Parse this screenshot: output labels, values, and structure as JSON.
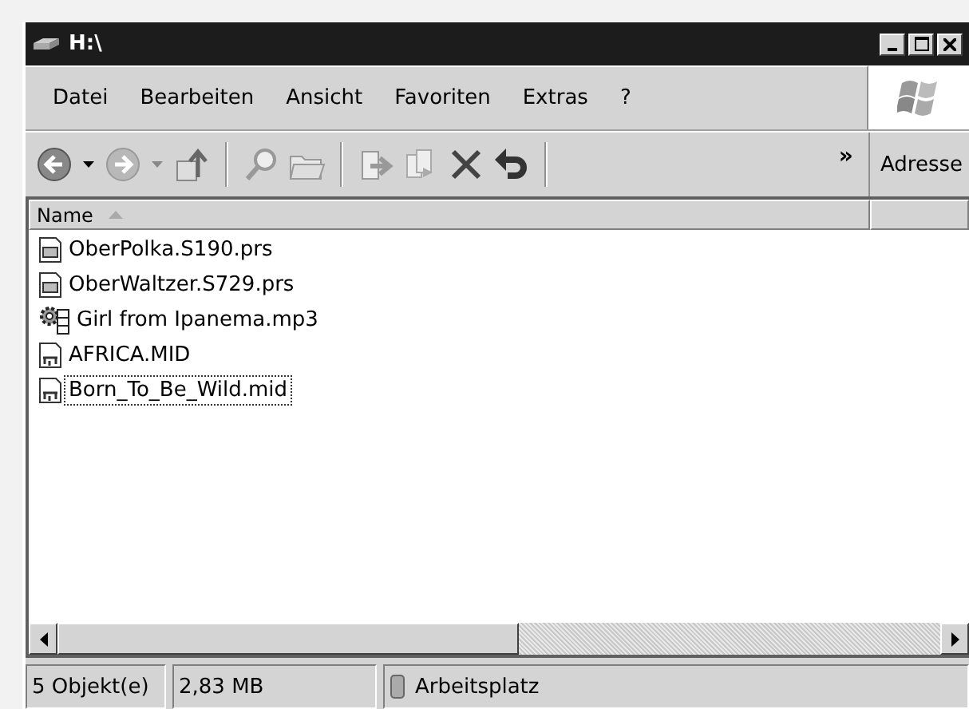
{
  "window": {
    "title": "H:\\"
  },
  "menu": [
    {
      "label": "Datei"
    },
    {
      "label": "Bearbeiten"
    },
    {
      "label": "Ansicht"
    },
    {
      "label": "Favoriten"
    },
    {
      "label": "Extras"
    },
    {
      "label": "?"
    }
  ],
  "toolbar": {
    "chevron": "»",
    "address_label": "Adresse"
  },
  "table": {
    "columns": [
      {
        "label": "Name",
        "sorted": true
      },
      {
        "sorted": false
      }
    ],
    "rows": [
      {
        "name": "OberPolka.S190.prs",
        "kind": "document",
        "focused": false
      },
      {
        "name": "OberWaltzer.S729.prs",
        "kind": "document",
        "focused": false
      },
      {
        "name": "Girl from Ipanema.mp3",
        "kind": "media",
        "focused": false
      },
      {
        "name": "AFRICA.MID",
        "kind": "midi",
        "focused": false
      },
      {
        "name": "Born_To_Be_Wild.mid",
        "kind": "midi",
        "focused": true
      }
    ]
  },
  "status_bar": {
    "count": "5 Objekt(e)",
    "size": "2,83 MB",
    "location": "Arbeitsplatz"
  }
}
